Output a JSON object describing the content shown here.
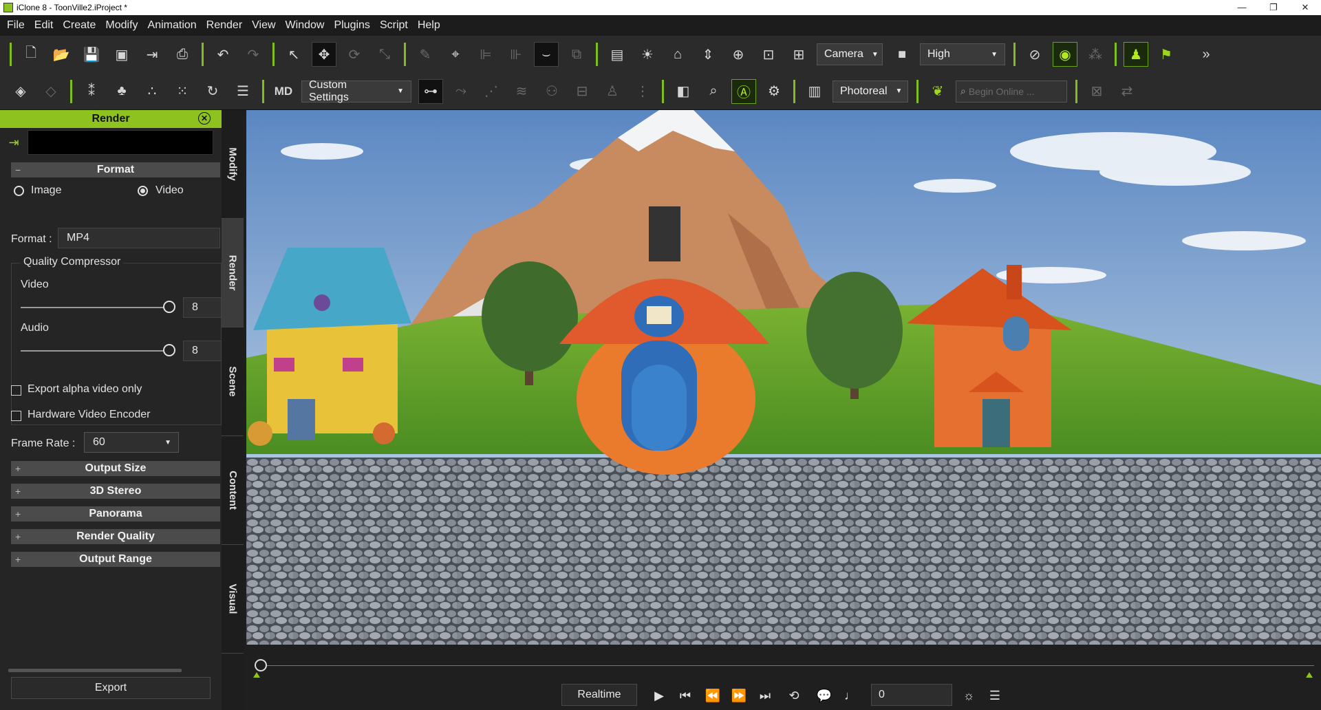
{
  "window": {
    "title": "iClone 8 - ToonVille2.iProject *",
    "controls": [
      "—",
      "❐",
      "✕"
    ]
  },
  "menu": [
    "File",
    "Edit",
    "Create",
    "Modify",
    "Animation",
    "Render",
    "View",
    "Window",
    "Plugins",
    "Script",
    "Help"
  ],
  "toolbar1": {
    "camera_label": "Camera",
    "quality_label": "High",
    "overflow": "»"
  },
  "toolbar2": {
    "settings_label": "Custom Settings",
    "render_mode_label": "Photoreal",
    "search_placeholder": "Begin Online ..."
  },
  "panel": {
    "title": "Render",
    "format_section": "Format",
    "radio_image": "Image",
    "radio_video": "Video",
    "selected_radio": "Video",
    "format_label": "Format :",
    "format_value": "MP4",
    "quality_group": "Quality Compressor",
    "video_label": "Video",
    "video_value": "8",
    "video_level": 1.0,
    "audio_label": "Audio",
    "audio_value": "8",
    "audio_level": 1.0,
    "export_alpha": "Export alpha video only",
    "hw_encoder": "Hardware Video Encoder",
    "framerate_label": "Frame Rate :",
    "framerate_value": "60",
    "collapsed_sections": [
      "Output Size",
      "3D Stereo",
      "Panorama",
      "Render Quality",
      "Output Range"
    ],
    "export_button": "Export"
  },
  "side_tabs": [
    "Modify",
    "Render",
    "Scene",
    "Content",
    "Visual"
  ],
  "active_tab": "Render",
  "timeline": {
    "realtime_button": "Realtime",
    "frame_value": "0"
  },
  "colors": {
    "accent": "#8dc21f",
    "panel_bg": "#252525",
    "toolbar_bg": "#2b2b2b"
  }
}
